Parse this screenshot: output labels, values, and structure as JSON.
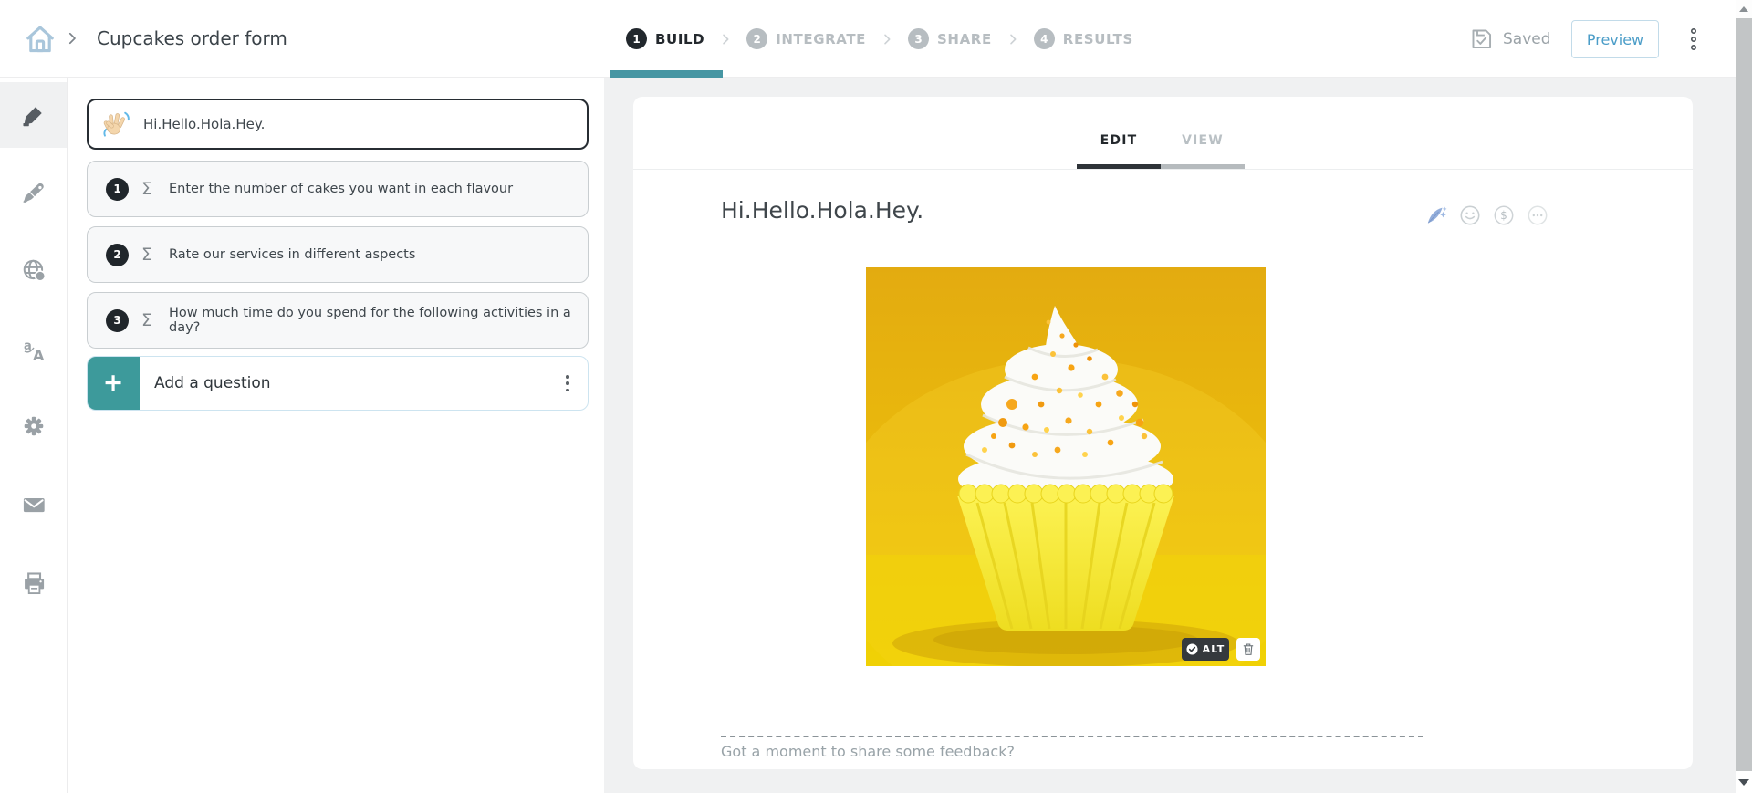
{
  "header": {
    "breadcrumb": "Cupcakes order form",
    "saved_label": "Saved",
    "preview_label": "Preview",
    "steps": [
      {
        "number": "1",
        "label": "BUILD",
        "state": "active"
      },
      {
        "number": "2",
        "label": "INTEGRATE",
        "state": "upcoming"
      },
      {
        "number": "3",
        "label": "SHARE",
        "state": "upcoming"
      },
      {
        "number": "4",
        "label": "RESULTS",
        "state": "upcoming"
      }
    ]
  },
  "sidebar": {
    "icons": [
      "compose-pencil",
      "design-brush",
      "web-globe",
      "translate",
      "settings-gear",
      "email-envelope",
      "print"
    ],
    "active_icon": "compose-pencil"
  },
  "question_panel": {
    "welcome_card": {
      "icon": "waving-hand",
      "title": "Hi.Hello.Hola.Hey."
    },
    "questions": [
      {
        "number": "1",
        "type_icon": "matrix-sigma",
        "text": "Enter the number of cakes you want in each flavour"
      },
      {
        "number": "2",
        "type_icon": "matrix-sigma",
        "text": "Rate our services in different aspects"
      },
      {
        "number": "3",
        "type_icon": "matrix-sigma",
        "text": "How much time do you spend for the following activities in a day?"
      }
    ],
    "add_question_label": "Add a question"
  },
  "editor": {
    "tabs": [
      {
        "label": "EDIT",
        "active": true
      },
      {
        "label": "VIEW",
        "active": false
      }
    ],
    "title": "Hi.Hello.Hola.Hey.",
    "toolbar_icons": [
      "ai-feather",
      "emoji-smiley",
      "variable-dollar",
      "more-ellipsis"
    ],
    "image": {
      "description": "yellow cupcake with white frosting and orange sprinkles on a yellow background",
      "alt_button_label": "ALT",
      "delete_icon": "trash"
    },
    "feedback_prompt": "Got a moment to share some feedback?"
  },
  "glyphs": {
    "sigma": "Σ",
    "plus": "+",
    "dollar": "$"
  },
  "colors": {
    "accent_teal": "#4696a3",
    "add_teal": "#3d9a9b",
    "preview_blue": "#4b9dc8",
    "step_active": "#22282d",
    "image_background": "#eebc0d"
  }
}
